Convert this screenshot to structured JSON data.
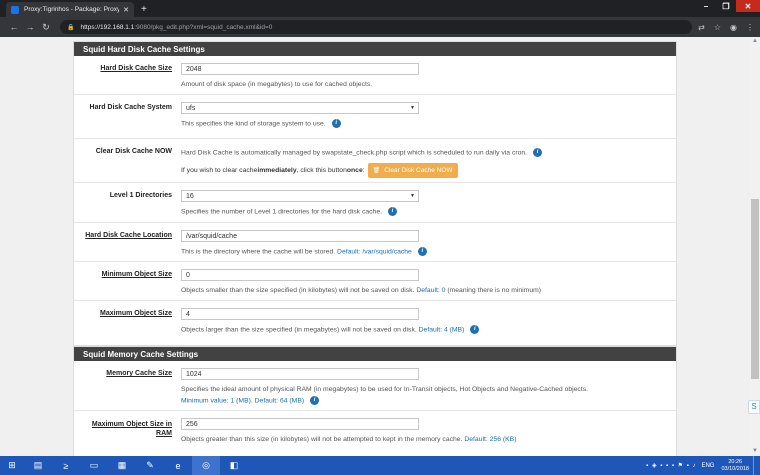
{
  "browser": {
    "tab_title": "Proxy:Tigrinhos - Package: Proxy",
    "tab_close": "✕",
    "new_tab": "+",
    "url_host": "https://192.168.1.1",
    "url_path": ":9080/pkg_edit.php?xml=squid_cache.xml&id=0",
    "window_controls": [
      "–",
      "❐",
      "✕"
    ],
    "nav_icons": [
      "arrow-left-icon",
      "arrow-right-icon",
      "reload-icon"
    ],
    "tool_icons": [
      "translate-icon",
      "star-icon",
      "profile-icon",
      "menu-icon"
    ]
  },
  "disk_panel": {
    "heading": "Squid Hard Disk Cache Settings",
    "rows": {
      "cache_size": {
        "label": "Hard Disk Cache Size",
        "value": "2048",
        "help": "Amount of disk space (in megabytes) to use for cached objects."
      },
      "cache_system": {
        "label": "Hard Disk Cache System",
        "value": "ufs",
        "help": "This specifies the kind of storage system to use."
      },
      "clear_cache": {
        "label": "Clear Disk Cache NOW",
        "help": "Hard Disk Cache is automatically managed by swapstate_check.php script which is scheduled to run daily via cron.",
        "prompt_before": "If you wish to clear cache ",
        "prompt_bold": "immediately",
        "prompt_mid": ", click this button ",
        "prompt_bold2": "once",
        "prompt_after": ":",
        "button": "Clear Disk Cache NOW"
      },
      "level1": {
        "label": "Level 1 Directories",
        "value": "16",
        "help": "Specifies the number of Level 1 directories for the hard disk cache."
      },
      "location": {
        "label": "Hard Disk Cache Location",
        "value": "/var/squid/cache",
        "help": "This is the directory where the cache will be stored.",
        "default": "Default: /var/squid/cache"
      },
      "min_obj": {
        "label": "Minimum Object Size",
        "value": "0",
        "help": "Objects smaller than the size specified (in kilobytes) will not be saved on disk.",
        "default": "Default: 0",
        "extra": "(meaning there is no minimum)"
      },
      "max_obj": {
        "label": "Maximum Object Size",
        "value": "4",
        "help": "Objects larger than the size specified (in megabytes) will not be saved on disk.",
        "default": "Default: 4 (MB)"
      }
    }
  },
  "memory_panel": {
    "heading": "Squid Memory Cache Settings",
    "rows": {
      "mem_size": {
        "label": "Memory Cache Size",
        "value": "1024",
        "help": "Specifies the ideal amount of physical RAM (in megabytes) to be used for In-Transit objects, Hot Objects and Negative-Cached objects.",
        "default": "Minimum value: 1 (MB). Default: 64 (MB)"
      },
      "max_mem_obj": {
        "label": "Maximum Object Size in RAM",
        "value": "256",
        "help": "Objects greater than this size (in kilobytes) will not be attempted to kept in the memory cache.",
        "default": "Default: 256 (KB)"
      }
    }
  },
  "taskbar": {
    "language": "ENG",
    "time": "20:26",
    "date": "03/10/2018"
  },
  "colors": {
    "panel_heading": "#424242",
    "button_warning": "#f0ad4e",
    "link_blue": "#1a6db3",
    "taskbar": "#1f57b8"
  }
}
